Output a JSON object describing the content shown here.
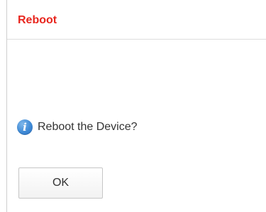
{
  "dialog": {
    "title": "Reboot",
    "message": "Reboot the Device?",
    "icon": "info-icon",
    "ok_label": "OK"
  },
  "colors": {
    "title": "#e8261e",
    "icon": "#3f8ad6"
  }
}
